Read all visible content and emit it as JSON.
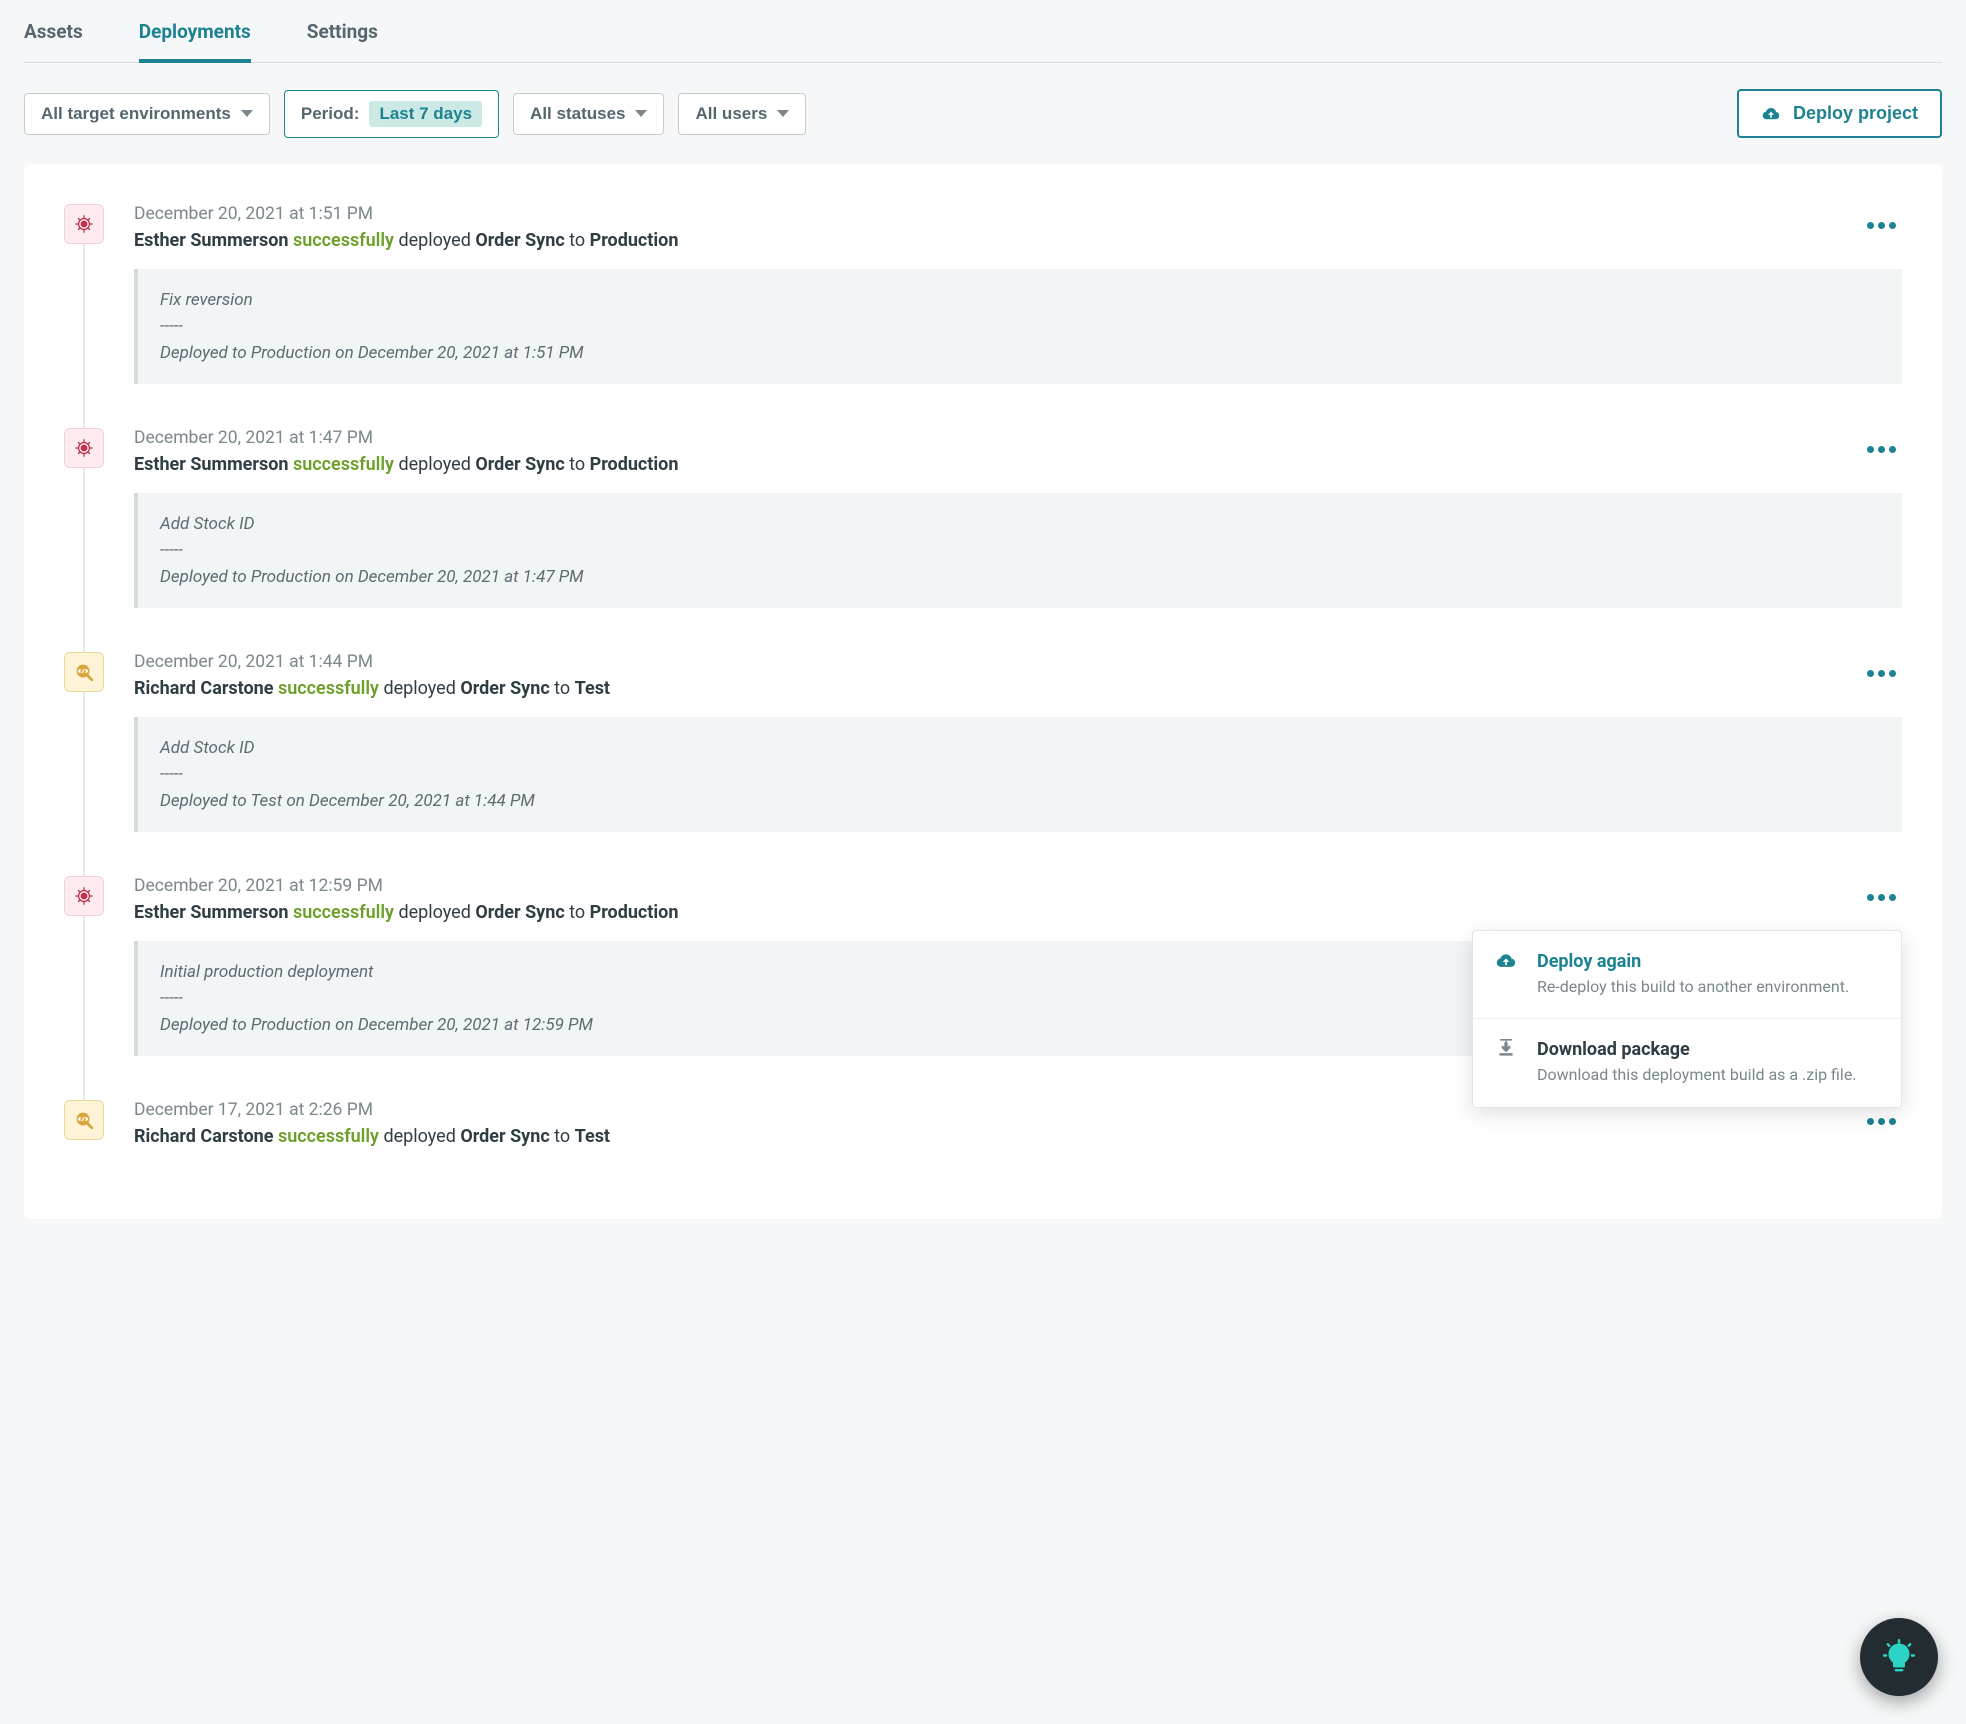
{
  "tabs": [
    {
      "label": "Assets",
      "active": false
    },
    {
      "label": "Deployments",
      "active": true
    },
    {
      "label": "Settings",
      "active": false
    }
  ],
  "filters": {
    "environments": "All target environments",
    "period_label": "Period:",
    "period_value": "Last 7 days",
    "statuses": "All statuses",
    "users": "All users"
  },
  "deploy_button": "Deploy project",
  "entries": [
    {
      "badge": "prod",
      "timestamp": "December 20, 2021 at 1:51 PM",
      "user": "Esther Summerson",
      "status": "successfully",
      "mid": " deployed ",
      "project": "Order Sync",
      "to": " to ",
      "env": "Production",
      "note": "Fix reversion\n-----\nDeployed to Production on December 20, 2021 at 1:51 PM",
      "menu_open": false
    },
    {
      "badge": "prod",
      "timestamp": "December 20, 2021 at 1:47 PM",
      "user": "Esther Summerson",
      "status": "successfully",
      "mid": " deployed ",
      "project": "Order Sync",
      "to": " to ",
      "env": "Production",
      "note": "Add Stock ID\n-----\nDeployed to Production on December 20, 2021 at 1:47 PM",
      "menu_open": false
    },
    {
      "badge": "test",
      "timestamp": "December 20, 2021 at 1:44 PM",
      "user": "Richard Carstone",
      "status": "successfully",
      "mid": " deployed ",
      "project": "Order Sync",
      "to": " to ",
      "env": "Test",
      "note": "Add Stock ID\n-----\nDeployed to Test on December 20, 2021 at 1:44 PM",
      "menu_open": false
    },
    {
      "badge": "prod",
      "timestamp": "December 20, 2021 at 12:59 PM",
      "user": "Esther Summerson",
      "status": "successfully",
      "mid": " deployed ",
      "project": "Order Sync",
      "to": " to ",
      "env": "Production",
      "note": "Initial production deployment\n-----\nDeployed to Production on December 20, 2021 at 12:59 PM",
      "menu_open": true
    },
    {
      "badge": "test",
      "timestamp": "December 17, 2021 at 2:26 PM",
      "user": "Richard Carstone",
      "status": "successfully",
      "mid": " deployed ",
      "project": "Order Sync",
      "to": " to ",
      "env": "Test",
      "note": "",
      "menu_open": false
    }
  ],
  "popover": {
    "deploy_again": {
      "title": "Deploy again",
      "desc": "Re-deploy this build to another environment."
    },
    "download": {
      "title": "Download package",
      "desc": "Download this deployment build as a .zip file."
    }
  }
}
